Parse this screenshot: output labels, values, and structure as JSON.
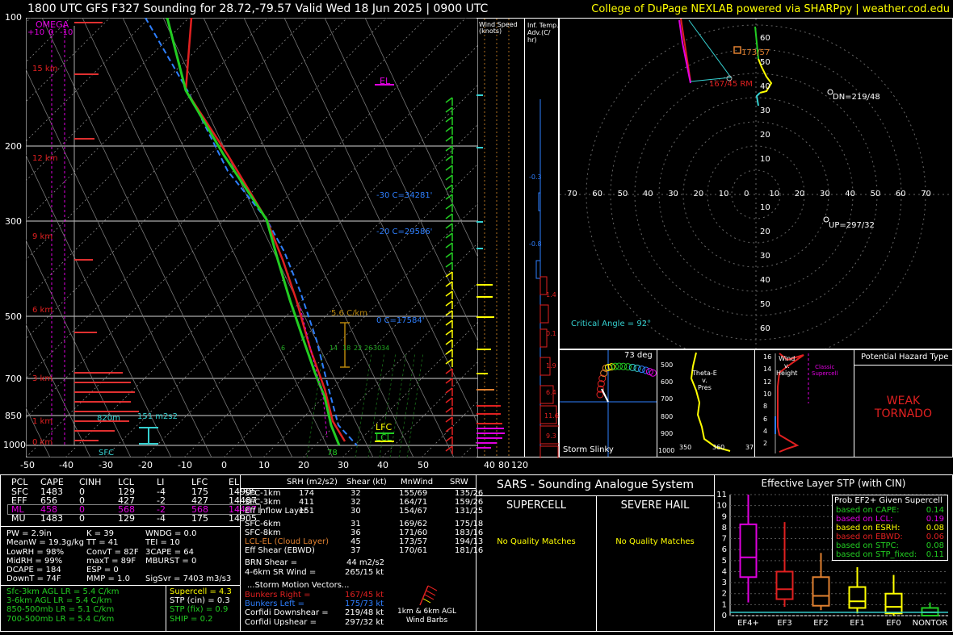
{
  "header": {
    "title": "1800 UTC GFS F327 Sounding for 28.72,-79.57 Valid  Wed 18 Jun 2025 | 0900 UTC",
    "credit": "College of DuPage NEXLAB powered via SHARPpy | weather.cod.edu"
  },
  "skewt": {
    "pressure_ticks": [
      "100",
      "200",
      "300",
      "500",
      "700",
      "850",
      "1000"
    ],
    "temp_ticks": [
      "-50",
      "-40",
      "-30",
      "-20",
      "-10",
      "0",
      "10",
      "20",
      "30",
      "40",
      "50"
    ],
    "omega_label": "OMEGA",
    "omega_ticks": [
      "+10",
      "0",
      "-10"
    ],
    "height_labels": [
      "15 km",
      "12 km",
      "9 km",
      "6 km",
      "3 km",
      "1 km",
      "0 km"
    ],
    "el_label": "EL",
    "lfc_label": "LFC",
    "lcl_label": "LCL",
    "sfc_label": "SFC",
    "srh_value": "151 m2s2",
    "inflow_bottom": "820m",
    "lapse_label": "5.6 C/km",
    "sfc_temp": "78",
    "isotherm_labels": [
      {
        "text": "-30 C=34281'",
        "color": "#2e7fff"
      },
      {
        "text": "-20 C=29586'",
        "color": "#2e7fff"
      },
      {
        "text": "0 C=17584'",
        "color": "#2e7fff"
      }
    ],
    "mixing_ratio_labels": [
      "6",
      "14",
      "18",
      "22",
      "26",
      "30",
      "34"
    ],
    "series": [
      {
        "name": "Temperature",
        "color": "#e02020"
      },
      {
        "name": "Dewpoint",
        "color": "#22cc22"
      },
      {
        "name": "Parcel",
        "color": "#2e7fff"
      }
    ]
  },
  "wind_column": {
    "label": "Wind Speed\n(knots)",
    "ticks": [
      "40",
      "80",
      "120"
    ]
  },
  "inferred_temp": {
    "label": "Inf. Temp.\nAdv.(C/\nhr)",
    "values": [
      "-0.3",
      "-0.8",
      "1.4",
      "0.1",
      "1.9",
      "6.4",
      "11.6",
      "9.3"
    ]
  },
  "hodograph": {
    "rings": [
      "70",
      "60",
      "50",
      "40",
      "30",
      "20",
      "10",
      "0",
      "10",
      "20",
      "30",
      "40",
      "50",
      "60",
      "70"
    ],
    "vertical_rings": [
      "60",
      "50",
      "40",
      "30",
      "20",
      "10",
      "10",
      "20",
      "30",
      "40",
      "50",
      "60"
    ],
    "right_mover": "167/45 RM",
    "mean_wind": "173/57",
    "downshear": "DN=219/48",
    "upshear": "UP=297/32",
    "critical_angle": "Critical Angle = 92°"
  },
  "storm_slinky": {
    "title": "Storm Slinky",
    "deg": "73 deg"
  },
  "theta_panel": {
    "title": "Theta-E\nv.\nPres",
    "p_ticks": [
      "500",
      "600",
      "700",
      "800",
      "900",
      "1000"
    ],
    "x_ticks": [
      "350",
      "360",
      "37"
    ]
  },
  "wind_height": {
    "title": "Wind\nv.\nHeight",
    "h_ticks": [
      "16",
      "14",
      "12",
      "10",
      "8",
      "6",
      "4",
      "2"
    ],
    "classic": "Classic\nSupercell"
  },
  "hazard": {
    "title": "Potential Hazard Type",
    "value": "WEAK\nTORNADO"
  },
  "parcels": {
    "headers": [
      "PCL",
      "CAPE",
      "CINH",
      "LCL",
      "LI",
      "LFC",
      "EL"
    ],
    "rows": [
      [
        "SFC",
        "1483",
        "0",
        "129",
        "-4",
        "175",
        "14905"
      ],
      [
        "EFF",
        "656",
        "0",
        "427",
        "-2",
        "427",
        "14487"
      ],
      [
        "ML",
        "458",
        "0",
        "568",
        "-2",
        "568",
        "14487"
      ],
      [
        "MU",
        "1483",
        "0",
        "129",
        "-4",
        "175",
        "14905"
      ]
    ]
  },
  "thermo": {
    "col1": [
      "PW = 2.9in",
      "MeanW = 19.3g/kg",
      "LowRH = 98%",
      "MidRH = 99%",
      "DCAPE = 184",
      "DownT = 74F"
    ],
    "col2": [
      "K = 39",
      "TT = 41",
      "ConvT = 82F",
      "maxT = 89F",
      "ESP = 0",
      "MMP = 1.0"
    ],
    "col3": [
      "WNDG = 0.0",
      "TEI = 10",
      "3CAPE = 64",
      "MBURST = 0",
      "",
      "SigSvr = 7403 m3/s3"
    ]
  },
  "lapse_rates": [
    "Sfc-3km AGL LR = 5.4 C/km",
    "3-6km AGL LR = 5.4 C/km",
    "850-500mb LR = 5.1 C/km",
    "700-500mb LR = 5.4 C/km"
  ],
  "composites": [
    "Supercell = 4.3",
    "STP (cin) = 0.3",
    "STP (fix) = 0.9",
    "SHIP = 0.2"
  ],
  "kinematics": {
    "headers": [
      "SRH (m2/s2)",
      "Shear (kt)",
      "MnWind",
      "SRW"
    ],
    "rows": [
      [
        "SFC-1km",
        "174",
        "32",
        "155/69",
        "135/26"
      ],
      [
        "SFC-3km",
        "411",
        "32",
        "164/71",
        "159/26"
      ],
      [
        "Eff Inflow Layer",
        "151",
        "30",
        "154/67",
        "131/25"
      ],
      [
        "SFC-6km",
        "31",
        "169/62",
        "175/18"
      ],
      [
        "SFC-8km",
        "36",
        "171/60",
        "183/16"
      ],
      [
        "LCL-EL (Cloud Layer)",
        "45",
        "173/57",
        "194/13"
      ],
      [
        "Eff Shear (EBWD)",
        "37",
        "170/61",
        "181/16"
      ]
    ],
    "brn": "BRN Shear =",
    "brn_value": "44 m2/s2",
    "sr_wind": "4-6km SR Wind =",
    "sr_wind_value": "265/15 kt",
    "storm_motion_title": "...Storm Motion Vectors...",
    "motions": [
      [
        "Bunkers Right =",
        "167/45 kt"
      ],
      [
        "Bunkers Left =",
        "175/73 kt"
      ],
      [
        "Corfidi Downshear =",
        "219/48 kt"
      ],
      [
        "Corfidi Upshear =",
        "297/32 kt"
      ]
    ],
    "barbs_label": "1km & 6km AGL\nWind Barbs"
  },
  "sars": {
    "title": "SARS - Sounding Analogue System",
    "supercell": "SUPERCELL",
    "hail": "SEVERE HAIL",
    "no_match": "No Quality Matches"
  },
  "stp": {
    "title": "Effective Layer STP (with CIN)",
    "y_ticks": [
      "11",
      "10",
      "9",
      "8",
      "7",
      "6",
      "5",
      "4",
      "3",
      "2",
      "1",
      "0"
    ],
    "categories": [
      "EF4+",
      "EF3",
      "EF2",
      "EF1",
      "EF0",
      "NONTOR"
    ],
    "legend_title": "Prob EF2+ Given Supercell",
    "legend": [
      [
        "based on CAPE:",
        "0.14",
        "#22cc22"
      ],
      [
        "based on LCL:",
        "0.19",
        "#e000e0"
      ],
      [
        "based on ESRH:",
        "0.08",
        "#ffff00"
      ],
      [
        "based on EBWD:",
        "0.06",
        "#e02020"
      ],
      [
        "based on STPC:",
        "0.08",
        "#22cc22"
      ],
      [
        "based on STP_fixed:",
        "0.11",
        "#22cc22"
      ]
    ]
  },
  "chart_data": {
    "type": "box",
    "title": "Effective Layer STP (with CIN)",
    "categories": [
      "EF4+",
      "EF3",
      "EF2",
      "EF1",
      "EF0",
      "NONTOR"
    ],
    "ylim": [
      0,
      11
    ],
    "boxes": [
      {
        "min": 1.2,
        "q1": 3.5,
        "median": 5.3,
        "q3": 8.3,
        "max": 11.0,
        "color": "#e000e0"
      },
      {
        "min": 0.8,
        "q1": 1.5,
        "median": 2.4,
        "q3": 4.0,
        "max": 8.5,
        "color": "#e02020"
      },
      {
        "min": 0.5,
        "q1": 0.9,
        "median": 1.8,
        "q3": 3.5,
        "max": 5.7,
        "color": "#e08030"
      },
      {
        "min": 0.2,
        "q1": 0.7,
        "median": 1.3,
        "q3": 2.6,
        "max": 4.4,
        "color": "#ffff00"
      },
      {
        "min": 0.0,
        "q1": 0.2,
        "median": 0.8,
        "q3": 2.0,
        "max": 3.7,
        "color": "#ffff00"
      },
      {
        "min": 0.0,
        "q1": 0.0,
        "median": 0.3,
        "q3": 0.7,
        "max": 1.2,
        "color": "#22cc22"
      }
    ],
    "stp_value": 0.3
  }
}
